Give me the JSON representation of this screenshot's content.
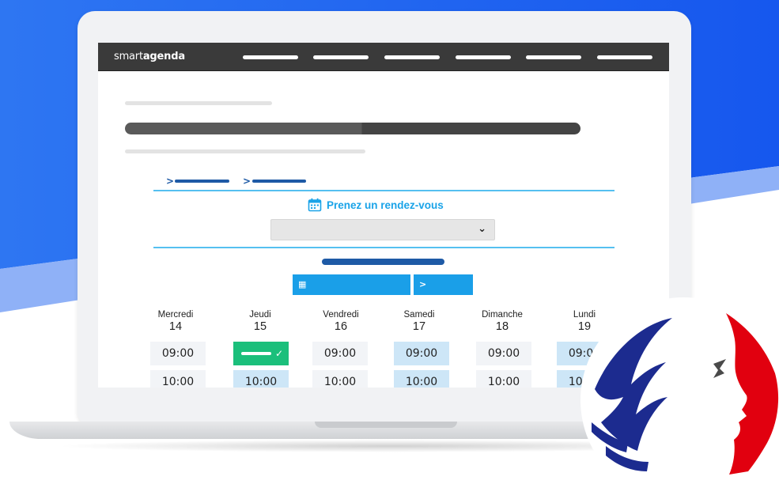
{
  "colors": {
    "background_blue": "#1f66f0",
    "topbar": "#3a3a3a",
    "accent_blue": "#1aa3e8",
    "dark_blue": "#1e5aa6",
    "slot_selected": "#1bbf7b",
    "slot_available": "#cde6f7",
    "marianne_blue": "#1c2b8f",
    "marianne_red": "#e1000f"
  },
  "app": {
    "brand_light": "smart",
    "brand_bold": "agenda"
  },
  "booking": {
    "title": "Prenez un rendez-vous",
    "title_icon": "calendar-icon",
    "select_icon": "chevron-down-icon",
    "next_icon": "chevron-right-icon",
    "prev_icon": "calendar-small-icon"
  },
  "days": [
    {
      "name": "Mercredi",
      "num": "14",
      "slots": [
        "09:00",
        "10:00"
      ]
    },
    {
      "name": "Jeudi",
      "num": "15",
      "slots": [
        "",
        "10:00"
      ]
    },
    {
      "name": "Vendredi",
      "num": "16",
      "slots": [
        "09:00",
        "10:00"
      ]
    },
    {
      "name": "Samedi",
      "num": "17",
      "slots": [
        "09:00",
        "10:00"
      ]
    },
    {
      "name": "Dimanche",
      "num": "18",
      "slots": [
        "09:00",
        "10:00"
      ]
    },
    {
      "name": "Lundi",
      "num": "19",
      "slots": [
        "09:00",
        "10:00"
      ]
    }
  ],
  "emblem": "marianne-emblem"
}
